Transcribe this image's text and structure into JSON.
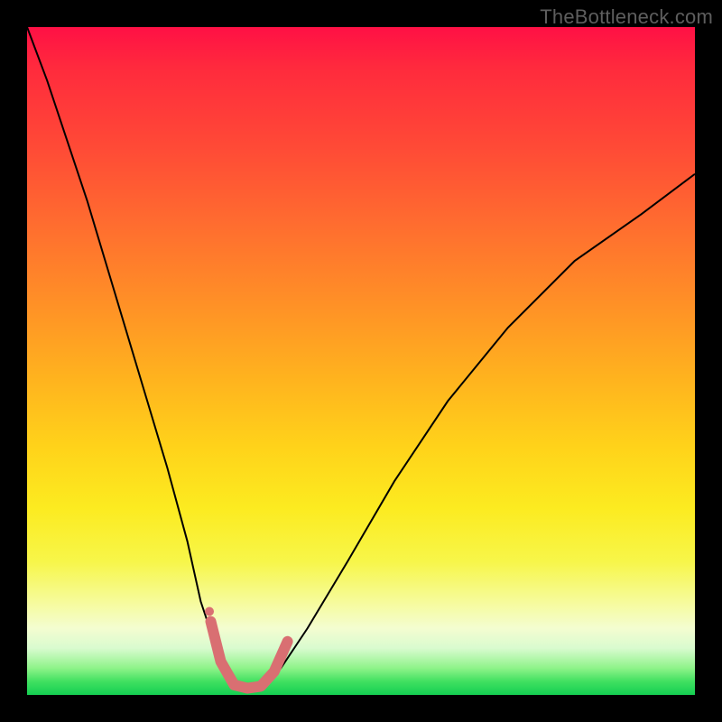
{
  "watermark": "TheBottleneck.com",
  "chart_data": {
    "type": "line",
    "title": "",
    "xlabel": "",
    "ylabel": "",
    "xlim": [
      0,
      100
    ],
    "ylim": [
      0,
      100
    ],
    "grid": false,
    "background_gradient": {
      "direction": "vertical",
      "stops": [
        {
          "pct": 0,
          "color": "#ff1045"
        },
        {
          "pct": 18,
          "color": "#ff4a36"
        },
        {
          "pct": 42,
          "color": "#ff9226"
        },
        {
          "pct": 63,
          "color": "#ffd31a"
        },
        {
          "pct": 80,
          "color": "#f7f649"
        },
        {
          "pct": 93,
          "color": "#d9fbcf"
        },
        {
          "pct": 100,
          "color": "#14cf52"
        }
      ]
    },
    "series": [
      {
        "name": "bottleneck-curve",
        "color": "#000000",
        "stroke_width": 2,
        "x": [
          0,
          3,
          6,
          9,
          12,
          15,
          18,
          21,
          24,
          26,
          28,
          29.5,
          31,
          33,
          35,
          38,
          42,
          48,
          55,
          63,
          72,
          82,
          92,
          100
        ],
        "y": [
          100,
          92,
          83,
          74,
          64,
          54,
          44,
          34,
          23,
          14,
          8,
          3.5,
          1,
          0.5,
          1,
          4,
          10,
          20,
          32,
          44,
          55,
          65,
          72,
          78
        ]
      },
      {
        "name": "minimum-marker",
        "color": "#d96f72",
        "stroke_width": 12,
        "linecap": "round",
        "x": [
          27.5,
          29,
          31,
          33,
          35,
          37,
          39
        ],
        "y": [
          11,
          5,
          1.5,
          1,
          1.3,
          3.5,
          8
        ]
      }
    ],
    "markers": [
      {
        "name": "marker-dot",
        "x": 27.3,
        "y": 12.5,
        "r": 5,
        "color": "#d96f72"
      }
    ]
  }
}
